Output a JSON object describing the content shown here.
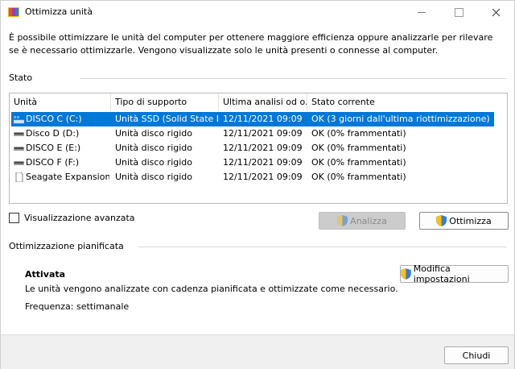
{
  "window": {
    "title": "Ottimizza unità"
  },
  "description": "È possibile ottimizzare le unità del computer per ottenere maggiore efficienza oppure analizzarle per rilevare se è necessario ottimizzarle. Vengono visualizzate solo le unità presenti o connesse al computer.",
  "status": {
    "group_label": "Stato",
    "columns": [
      "Unità",
      "Tipo di supporto",
      "Ultima analisi od o...",
      "Stato corrente"
    ],
    "rows": [
      {
        "drive": "DISCO C (C:)",
        "media": "Unità SSD (Solid State D...",
        "last": "12/11/2021 09:09",
        "state": "OK (3 giorni dall'ultima riottimizzazione)",
        "icon": "ssd-drive-icon",
        "selected": true
      },
      {
        "drive": "Disco D (D:)",
        "media": "Unità disco rigido",
        "last": "12/11/2021 09:09",
        "state": "OK (0% frammentati)",
        "icon": "hdd-drive-icon"
      },
      {
        "drive": "DISCO E (E:)",
        "media": "Unità disco rigido",
        "last": "12/11/2021 09:09",
        "state": "OK (0% frammentati)",
        "icon": "hdd-drive-icon"
      },
      {
        "drive": "DISCO F (F:)",
        "media": "Unità disco rigido",
        "last": "12/11/2021 09:09",
        "state": "OK (0% frammentati)",
        "icon": "hdd-drive-icon"
      },
      {
        "drive": "Seagate Expansion ...",
        "media": "Unità disco rigido",
        "last": "12/11/2021 09:09",
        "state": "OK (0% frammentati)",
        "icon": "file-volume-icon"
      }
    ]
  },
  "advanced_view_label": "Visualizzazione avanzata",
  "buttons": {
    "analyze": "Analizza",
    "optimize": "Ottimizza",
    "change_settings": "Modifica impostazioni",
    "close": "Chiudi"
  },
  "scheduled": {
    "group_label": "Ottimizzazione pianificata",
    "state": "Attivata",
    "text": "Le unità vengono analizzate con cadenza pianificata e ottimizzate come necessario.",
    "frequency": "Frequenza: settimanale"
  },
  "colors": {
    "selection": "#0078d7",
    "disabled_button": "#cccccc"
  }
}
